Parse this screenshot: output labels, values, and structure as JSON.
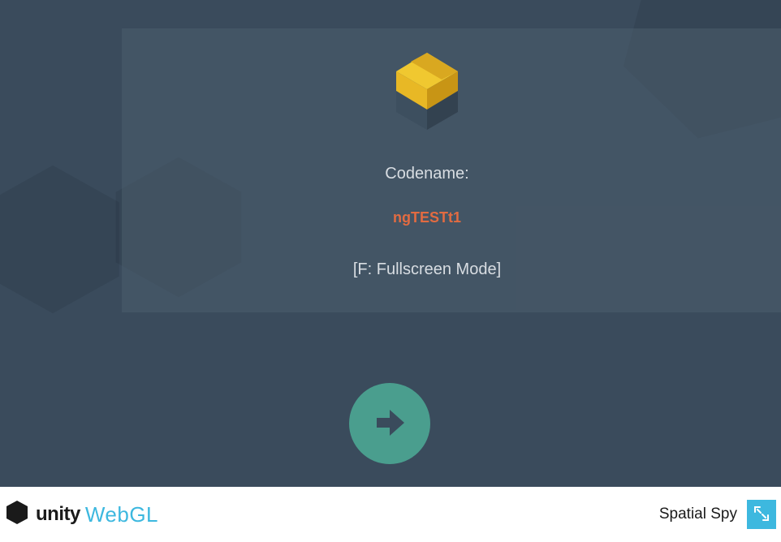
{
  "game": {
    "codename_label": "Codename:",
    "codename_value": "ngTESTt1",
    "fullscreen_hint": "[F: Fullscreen Mode]"
  },
  "footer": {
    "unity_text": "unity",
    "webgl_text": "WebGL",
    "game_title": "Spatial Spy"
  },
  "colors": {
    "game_bg": "#3a4b5c",
    "panel_bg": "rgba(80, 97, 112, 0.45)",
    "accent_orange": "#e26b41",
    "accent_teal": "#4a9e8e",
    "accent_cyan": "#3db8df"
  }
}
